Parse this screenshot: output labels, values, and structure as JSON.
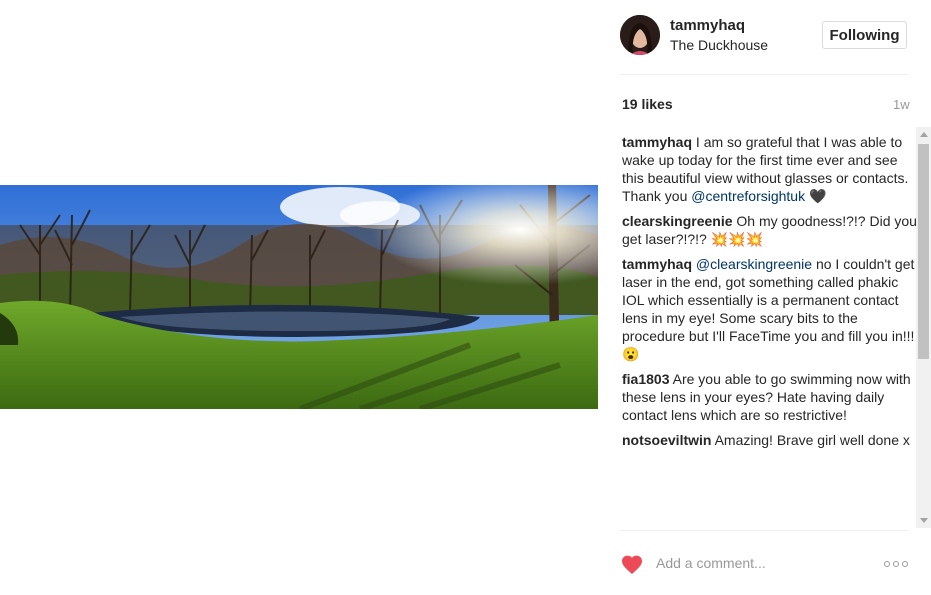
{
  "post": {
    "username": "tammyhaq",
    "location": "The Duckhouse",
    "follow_label": "Following",
    "likes": "19 likes",
    "time_ago": "1w",
    "add_comment_placeholder": "Add a comment..."
  },
  "comments": [
    {
      "user": "tammyhaq",
      "text_before": "I am so grateful that I was able to wake up today for the first time ever and see this beautiful view without glasses or contacts. Thank you ",
      "mention": "@centreforsightuk",
      "text_after": " 🖤"
    },
    {
      "user": "clearskingreenie",
      "text_before": "Oh my goodness!?!? Did you get laser?!?!? 💥💥💥",
      "mention": "",
      "text_after": ""
    },
    {
      "user": "tammyhaq",
      "text_before": "",
      "mention": "@clearskingreenie",
      "text_after": " no I couldn't get laser in the end, got something called phakic IOL which essentially is a permanent contact lens in my eye! Some scary bits to the procedure but I'll FaceTime you and fill you in!!! 😮"
    },
    {
      "user": "fia1803",
      "text_before": "Are you able to go swimming now with these lens in your eyes? Hate having daily contact lens which are so restrictive!",
      "mention": "",
      "text_after": ""
    },
    {
      "user": "notsoeviltwin",
      "text_before": "Amazing! Brave girl well done x",
      "mention": "",
      "text_after": ""
    }
  ],
  "icons": {
    "like": "heart-icon",
    "more": "more-options-icon",
    "avatar": "profile-avatar"
  },
  "colors": {
    "like_heart": "#ed4956",
    "mention": "#003569",
    "muted_text": "#999999",
    "border": "#dbdbdb"
  }
}
